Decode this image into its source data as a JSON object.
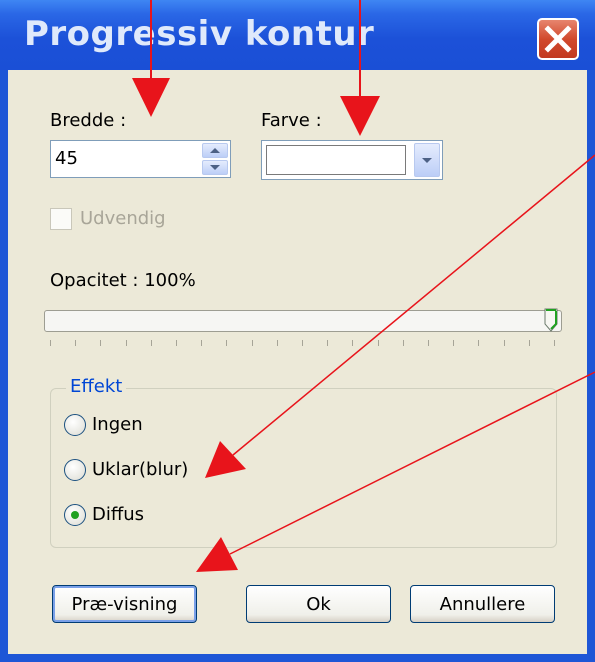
{
  "window": {
    "title": "Progressiv kontur",
    "close_icon": "close-icon"
  },
  "fields": {
    "width_label": "Bredde :",
    "width_value": "45",
    "color_label": "Farve :",
    "color_value": "#ffffff",
    "outside_label": "Udvendig",
    "opacity_label": "Opacitet : 100%",
    "opacity_level": 1.0
  },
  "effect_group": {
    "legend": "Effekt",
    "options": [
      {
        "label": "Ingen",
        "selected": false
      },
      {
        "label": "Uklar(blur)",
        "selected": false
      },
      {
        "label": "Diffus",
        "selected": true
      }
    ]
  },
  "buttons": {
    "preview": "Præ-visning",
    "ok": "Ok",
    "cancel": "Annullere"
  },
  "colors": {
    "titlebar": "#1c51d8",
    "dialog_bg": "#ece9d8",
    "arrow": "#e8141b",
    "selected_radio": "#21a121"
  }
}
